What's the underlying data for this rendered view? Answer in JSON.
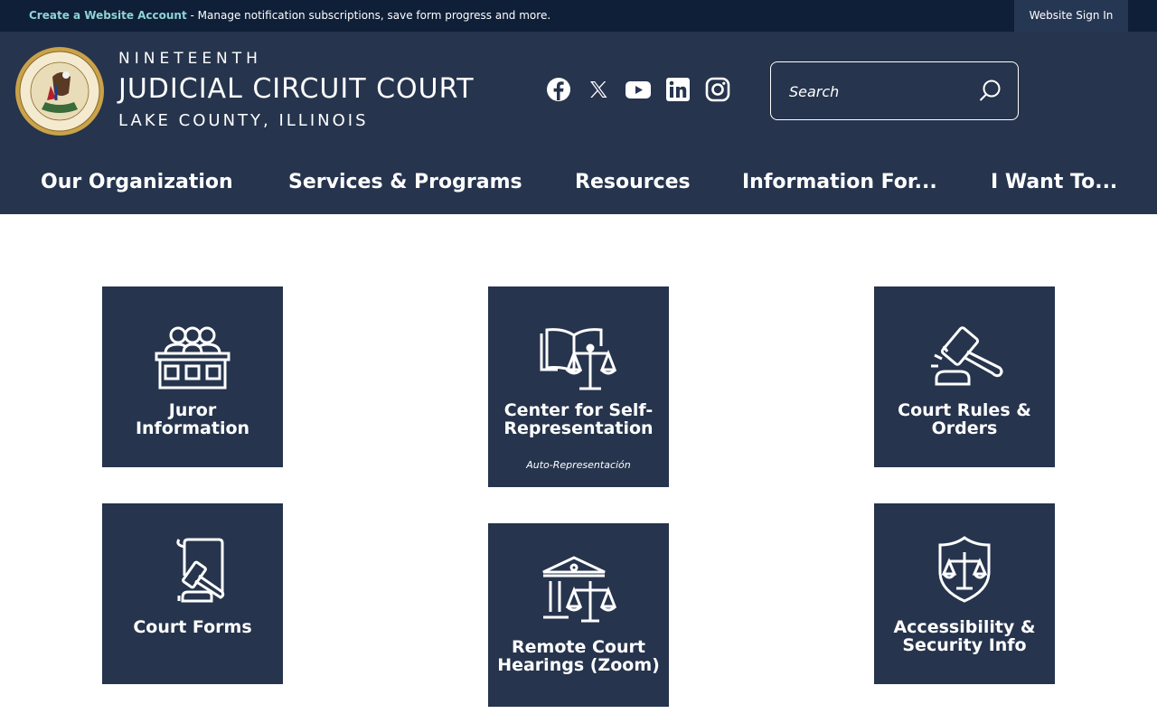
{
  "topbar": {
    "create_account": "Create a Website Account",
    "message": " - Manage notification subscriptions, save form progress and more.",
    "sign_in": "Website Sign In"
  },
  "header": {
    "seal_text": "SEAL OF THE STATE OF ILLINOIS · AUG. 26th 1818",
    "brand_line1": "NINETEENTH",
    "brand_line2": "JUDICIAL CIRCUIT COURT",
    "brand_line3": "LAKE COUNTY, ILLINOIS"
  },
  "social": [
    {
      "name": "facebook-icon"
    },
    {
      "name": "x-icon"
    },
    {
      "name": "youtube-icon"
    },
    {
      "name": "linkedin-icon"
    },
    {
      "name": "instagram-icon"
    }
  ],
  "search": {
    "placeholder": "Search",
    "value": ""
  },
  "nav": [
    {
      "label": "Our Organization"
    },
    {
      "label": "Services & Programs"
    },
    {
      "label": "Resources"
    },
    {
      "label": "Information For..."
    },
    {
      "label": "I Want To..."
    }
  ],
  "tiles": [
    {
      "label": "Juror Information",
      "icon": "jury-box-icon"
    },
    {
      "label": "Center for Self-Representation",
      "sub": "Auto-Representación",
      "icon": "book-scales-icon"
    },
    {
      "label": "Court Rules & Orders",
      "icon": "gavel-icon"
    },
    {
      "label": "Court Forms",
      "icon": "document-gavel-icon"
    },
    {
      "label": "Remote Court Hearings (Zoom)",
      "icon": "courthouse-scales-icon"
    },
    {
      "label": "Accessibility & Security Info",
      "icon": "shield-scales-icon"
    }
  ],
  "colors": {
    "topbar": "#0f1f38",
    "header": "#26344d",
    "tile": "#26344d",
    "link_accent": "#8fd3d3"
  }
}
